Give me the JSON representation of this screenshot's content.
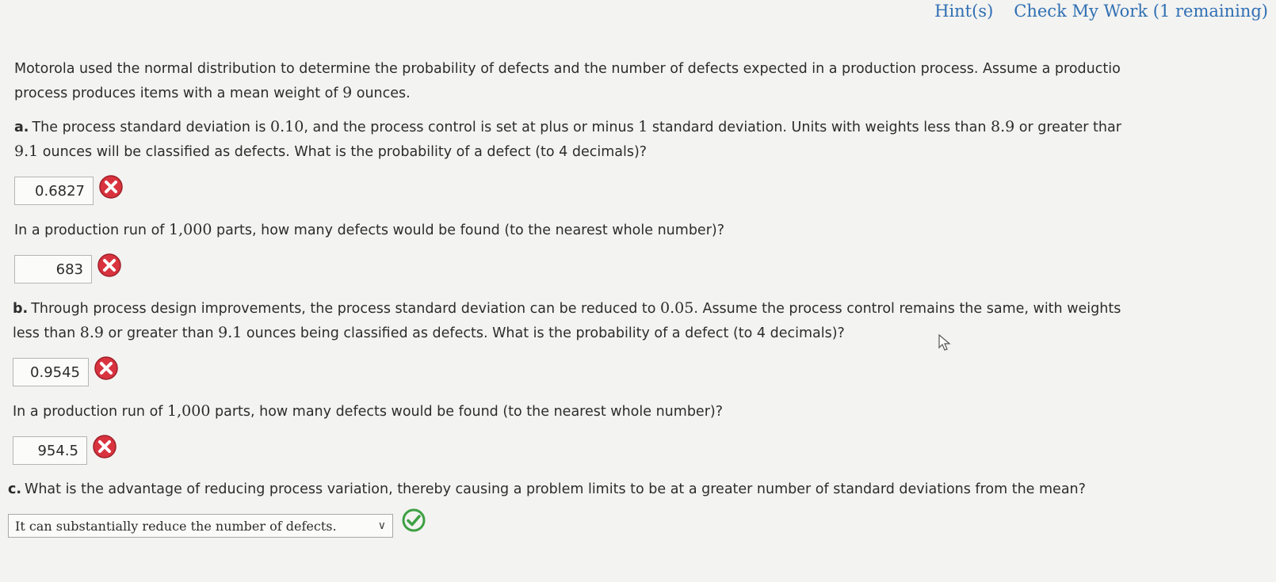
{
  "header": {
    "hints_label": "Hint(s)",
    "check_label": "Check My Work (1 remaining)"
  },
  "intro": {
    "text1": "Motorola used the normal distribution to determine the probability of defects and the number of defects expected in a production process. Assume a productio",
    "text2a": "process produces items with a mean weight of ",
    "mean": "9",
    "text2b": " ounces."
  },
  "part_a": {
    "label": "a.",
    "q1_pre": "The process standard deviation is ",
    "sd": "0.10",
    "q1_mid": ", and the process control is set at plus or minus ",
    "k": "1",
    "q1_post": " standard deviation. Units with weights less than ",
    "lower": "8.9",
    "q1_or": " or greater thar",
    "upper": "9.1",
    "q1_end": " ounces will be classified as defects. What is the probability of a defect (to 4 decimals)?",
    "answer1": "0.6827",
    "q2_pre": "In a production run of ",
    "parts": "1,000",
    "q2_post": " parts, how many defects would be found (to the nearest whole number)?",
    "answer2": "683"
  },
  "part_b": {
    "label": "b.",
    "q1_pre": "Through process design improvements, the process standard deviation can be reduced to ",
    "sd": "0.05",
    "q1_post": ". Assume the process control remains the same, with weights",
    "q1_line2_pre": "less than ",
    "lower": "8.9",
    "q1_or": " or greater than ",
    "upper": "9.1",
    "q1_end": " ounces being classified as defects. What is the probability of a defect (to 4 decimals)?",
    "answer1": "0.9545",
    "q2_pre": "In a production run of ",
    "parts": "1,000",
    "q2_post": " parts, how many defects would be found (to the nearest whole number)?",
    "answer2": "954.5"
  },
  "part_c": {
    "label": "c.",
    "question": "What is the advantage of reducing process variation, thereby causing a problem limits to be at a greater number of standard deviations from the mean?",
    "selected": "It can substantially reduce the number of defects.",
    "chevron": "∨"
  },
  "icons": {
    "incorrect": "incorrect-x-icon",
    "correct": "correct-check-icon",
    "incorrect_color": "#d8333f",
    "correct_color": "#3ea043"
  }
}
